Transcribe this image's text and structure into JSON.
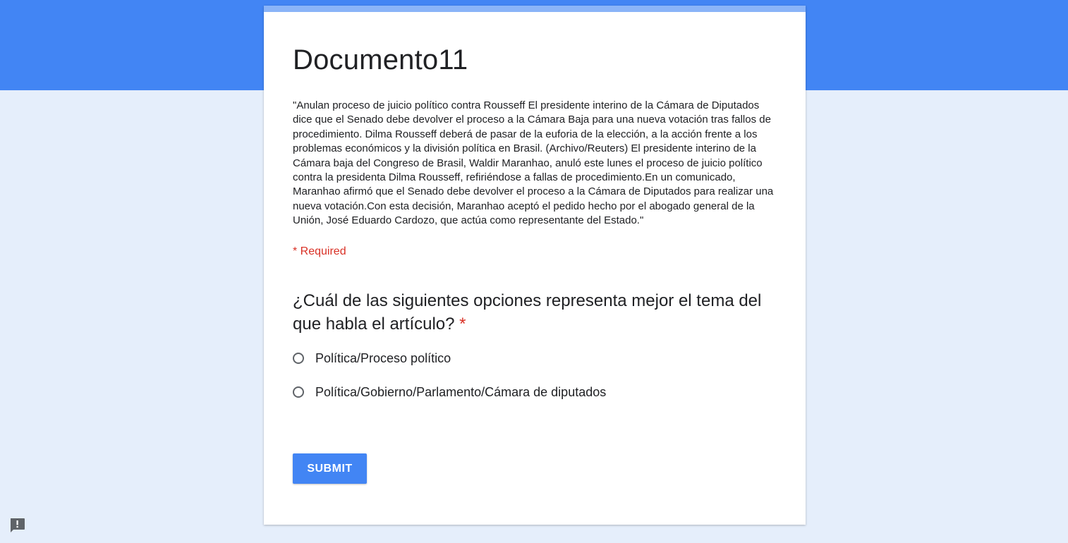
{
  "form": {
    "title": "Documento11",
    "description": "\"Anulan proceso de juicio político contra Rousseff El presidente interino de la Cámara de Diputados dice que el Senado debe devolver el proceso a la Cámara Baja para una nueva votación tras fallos de procedimiento. Dilma Rousseff deberá de pasar de la euforia de la elección, a la acción frente a los problemas económicos y la división política en Brasil. (Archivo/Reuters) El presidente interino de la Cámara baja del Congreso de Brasil, Waldir Maranhao, anuló este lunes el proceso de juicio político contra la presidenta Dilma Rousseff, refiriéndose a fallas de procedimiento.En un comunicado, Maranhao afirmó que el Senado debe devolver el proceso a la Cámara de Diputados para realizar una nueva votación.Con esta decisión, Maranhao aceptó el pedido hecho por el abogado general de la Unión, José Eduardo Cardozo, que actúa como representante del Estado.\"",
    "required_note": "* Required"
  },
  "question": {
    "title": "¿Cuál de las siguientes opciones representa mejor el tema del que habla el artículo?",
    "required_marker": "*",
    "options": [
      {
        "label": "Política/Proceso político",
        "selected": false
      },
      {
        "label": "Política/Gobierno/Parlamento/Cámara de diputados",
        "selected": false
      }
    ]
  },
  "actions": {
    "submit_label": "SUBMIT"
  },
  "icons": {
    "feedback": "report-feedback-icon"
  },
  "colors": {
    "header": "#4285f4",
    "page_background": "#e5eefb",
    "card_accent": "#8ab4f8",
    "required": "#d93025",
    "button": "#4285f4"
  }
}
